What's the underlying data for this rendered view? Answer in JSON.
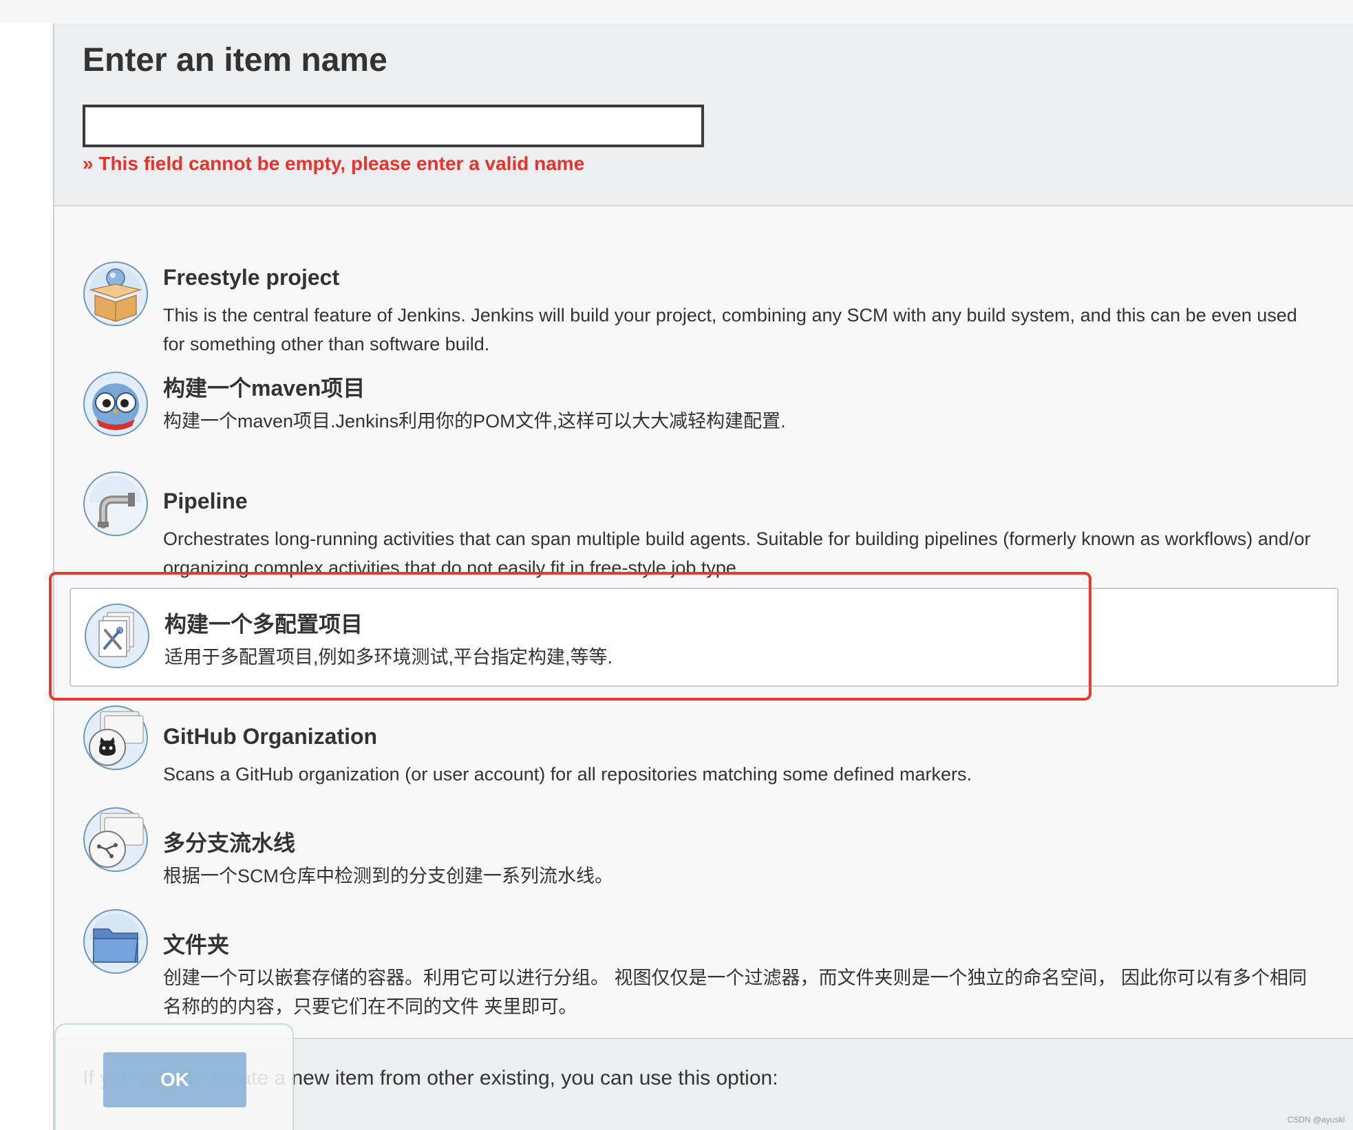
{
  "header": {
    "title": "Enter an item name",
    "name_value": "",
    "error": "» This field cannot be empty, please enter a valid name"
  },
  "items": [
    {
      "title": "Freestyle project",
      "desc": "This is the central feature of Jenkins. Jenkins will build your project, combining any SCM with any build system, and this can be even used for something other than software build.",
      "icon": "freestyle-box-icon"
    },
    {
      "title": "构建一个maven项目",
      "desc": "构建一个maven项目.Jenkins利用你的POM文件,这样可以大大减轻构建配置.",
      "icon": "maven-owl-icon"
    },
    {
      "title": "Pipeline",
      "desc": "Orchestrates long-running activities that can span multiple build agents. Suitable for building pipelines (formerly known as workflows) and/or organizing complex activities that do not easily fit in free-style job type.",
      "icon": "pipeline-pipe-icon"
    },
    {
      "title": "构建一个多配置项目",
      "desc": "适用于多配置项目,例如多环境测试,平台指定构建,等等.",
      "icon": "multi-config-icon"
    },
    {
      "title": "GitHub Organization",
      "desc": "Scans a GitHub organization (or user account) for all repositories matching some defined markers.",
      "icon": "github-organization-icon"
    },
    {
      "title": "多分支流水线",
      "desc": "根据一个SCM仓库中检测到的分支创建一系列流水线。",
      "icon": "multibranch-pipeline-icon"
    },
    {
      "title": "文件夹",
      "desc": "创建一个可以嵌套存储的容器。利用它可以进行分组。 视图仅仅是一个过滤器，而文件夹则是一个独立的命名空间， 因此你可以有多个相同名称的的内容，只要它们在不同的文件 夹里即可。",
      "icon": "folder-icon"
    }
  ],
  "footer": {
    "copy_hint": "If you want to create a new item from other existing, you can use this option:",
    "ok_label": "OK"
  },
  "watermark": "CSDN @ayuski",
  "colors": {
    "error": "#e8322b",
    "highlight": "#e8392f",
    "ok_button": "#8bb3d6"
  }
}
